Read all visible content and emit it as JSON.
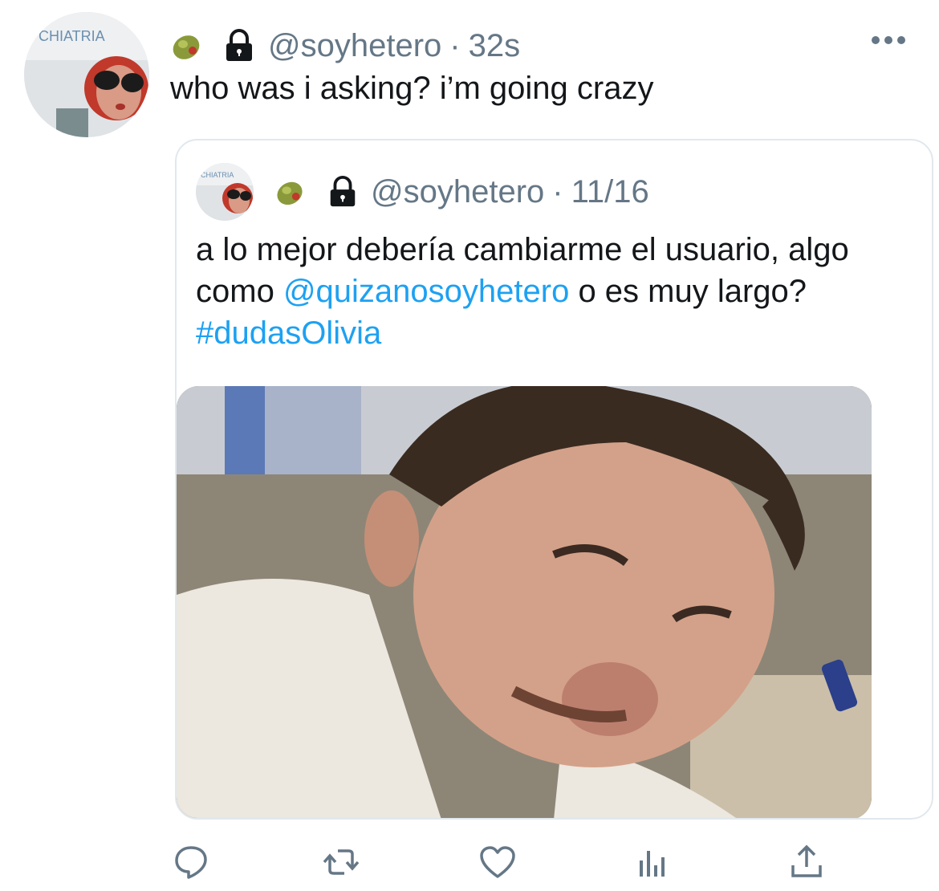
{
  "tweet": {
    "handle": "@soyhetero",
    "separator": "·",
    "time": "32s",
    "text": "who was i asking? i’m going crazy",
    "avatar_sign_text": "CHIATRIA"
  },
  "quoted": {
    "handle": "@soyhetero",
    "separator": "·",
    "date": "11/16",
    "text_part1": "a lo mejor debería cambiarme el usuario, algo como ",
    "mention": "@quizanosoyhetero",
    "text_part2": " o es muy largo? ",
    "hashtag": "#dudasOlivia",
    "avatar_sign_text": "CHIATRIA"
  },
  "icons": {
    "olive": "olive-emoji-icon",
    "lock": "lock-icon",
    "more": "more-icon",
    "reply": "reply-icon",
    "retweet": "retweet-icon",
    "like": "heart-icon",
    "analytics": "analytics-icon",
    "share": "share-icon"
  },
  "colors": {
    "link": "#1da1f2",
    "secondary_text": "#657786",
    "border": "#e1e8ed"
  }
}
